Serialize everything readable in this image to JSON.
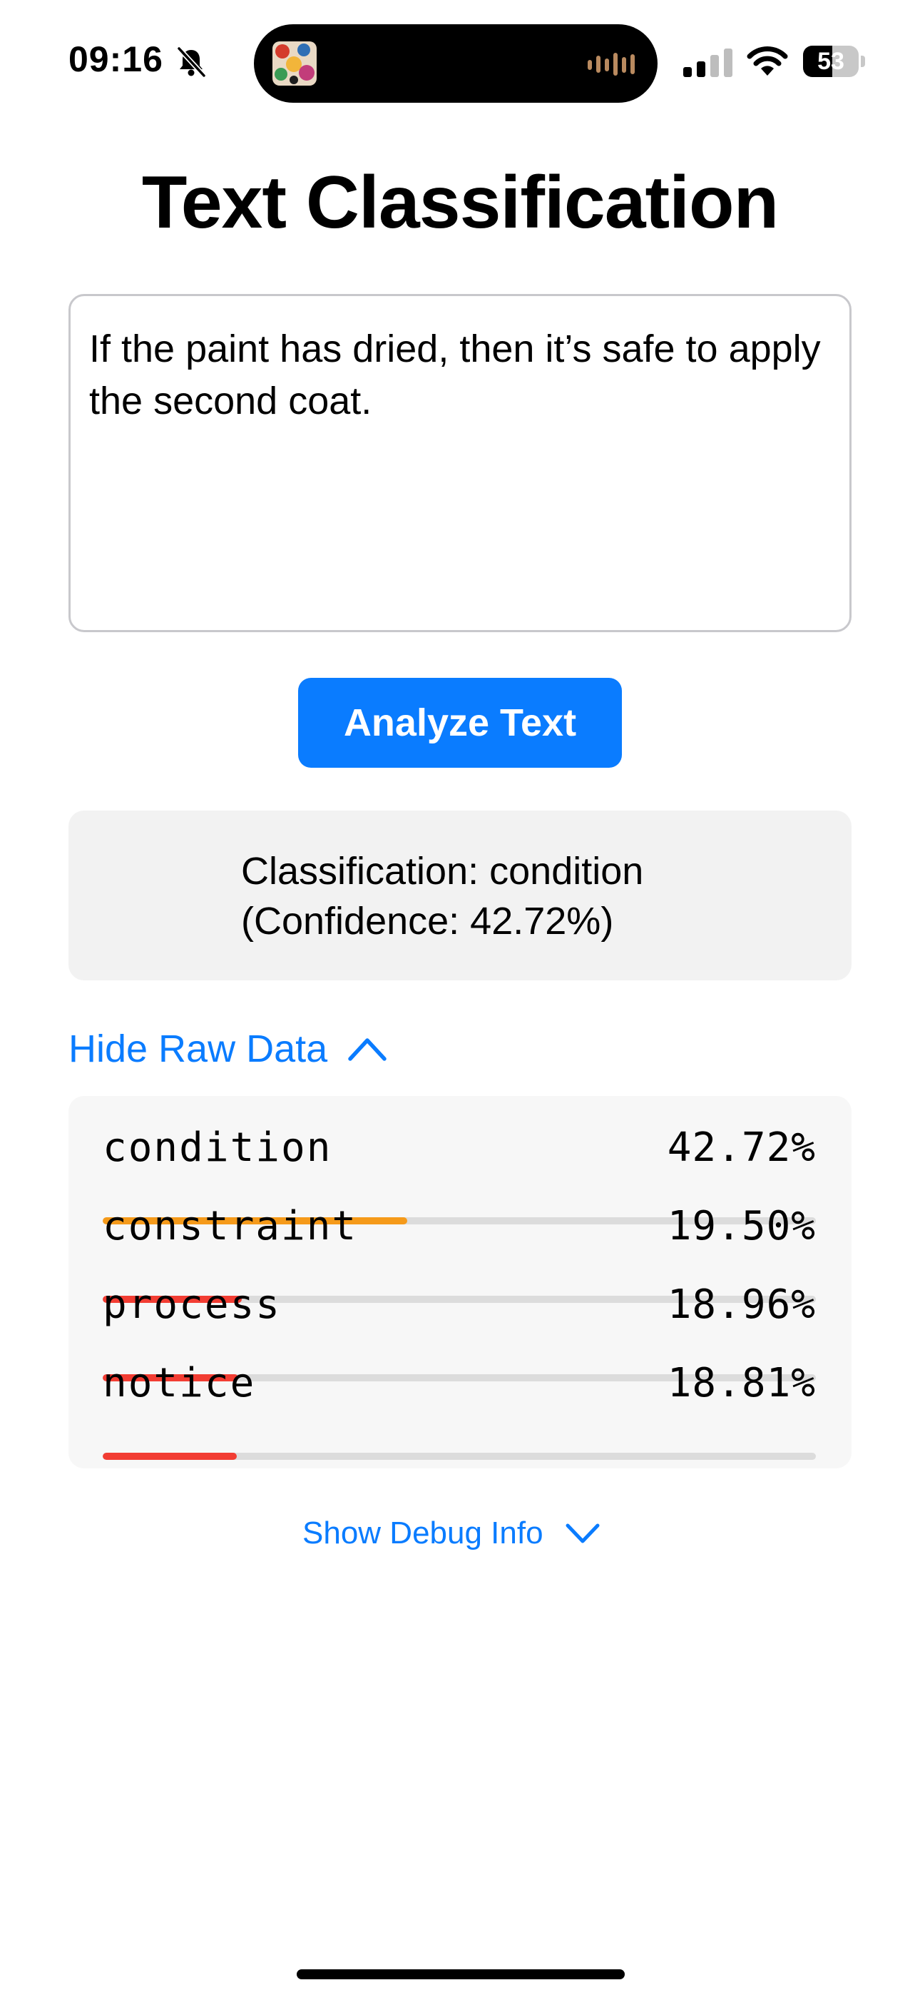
{
  "status_bar": {
    "time": "09:16",
    "battery": "53",
    "battery_level": 0.53
  },
  "title": "Text Classification",
  "input": {
    "value": "If the paint has dried, then it’s safe to apply the second coat."
  },
  "analyze_button": "Analyze Text",
  "result": {
    "line1": "Classification: condition",
    "line2": "(Confidence: 42.72%)"
  },
  "raw_toggle": "Hide Raw Data",
  "raw_data": [
    {
      "label": "condition",
      "value": "42.72%",
      "fraction": 0.4272,
      "color": "#f59a1a"
    },
    {
      "label": "constraint",
      "value": "19.50%",
      "fraction": 0.195,
      "color": "#f23d33"
    },
    {
      "label": "process",
      "value": "18.96%",
      "fraction": 0.1896,
      "color": "#f23d33"
    },
    {
      "label": "notice",
      "value": "18.81%",
      "fraction": 0.1881,
      "color": "#f23d33"
    }
  ],
  "debug_toggle": "Show Debug Info"
}
